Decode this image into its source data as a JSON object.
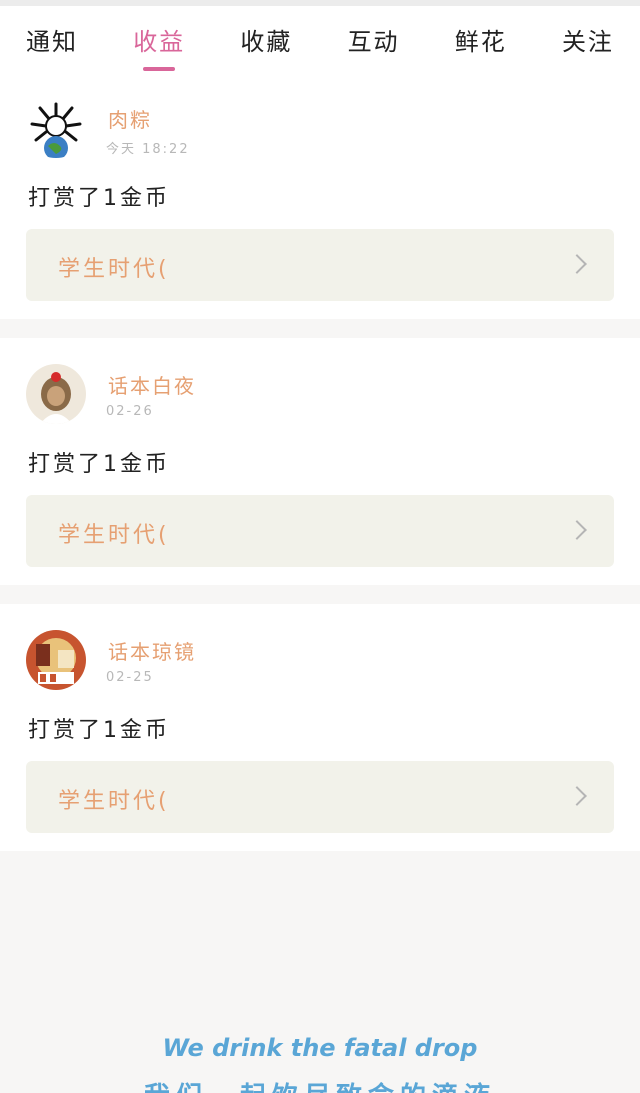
{
  "tabs": [
    {
      "label": "通知"
    },
    {
      "label": "收益"
    },
    {
      "label": "收藏"
    },
    {
      "label": "互动"
    },
    {
      "label": "鲜花"
    },
    {
      "label": "关注"
    }
  ],
  "active_tab": "收益",
  "items": [
    {
      "user": "肉粽",
      "time": "今天 18:22",
      "action": "打赏了1金币",
      "link": "学生时代("
    },
    {
      "user": "话本白夜",
      "time": "02-26",
      "action": "打赏了1金币",
      "link": "学生时代("
    },
    {
      "user": "话本琼镜",
      "time": "02-25",
      "action": "打赏了1金币",
      "link": "学生时代("
    }
  ],
  "footer": {
    "line1": "We drink the fatal drop",
    "line2": "我们一起饮尽致命的滴液"
  },
  "colors": {
    "active_tab": "#d9669a",
    "username": "#e6a072",
    "footer": "#5aa6d6"
  }
}
